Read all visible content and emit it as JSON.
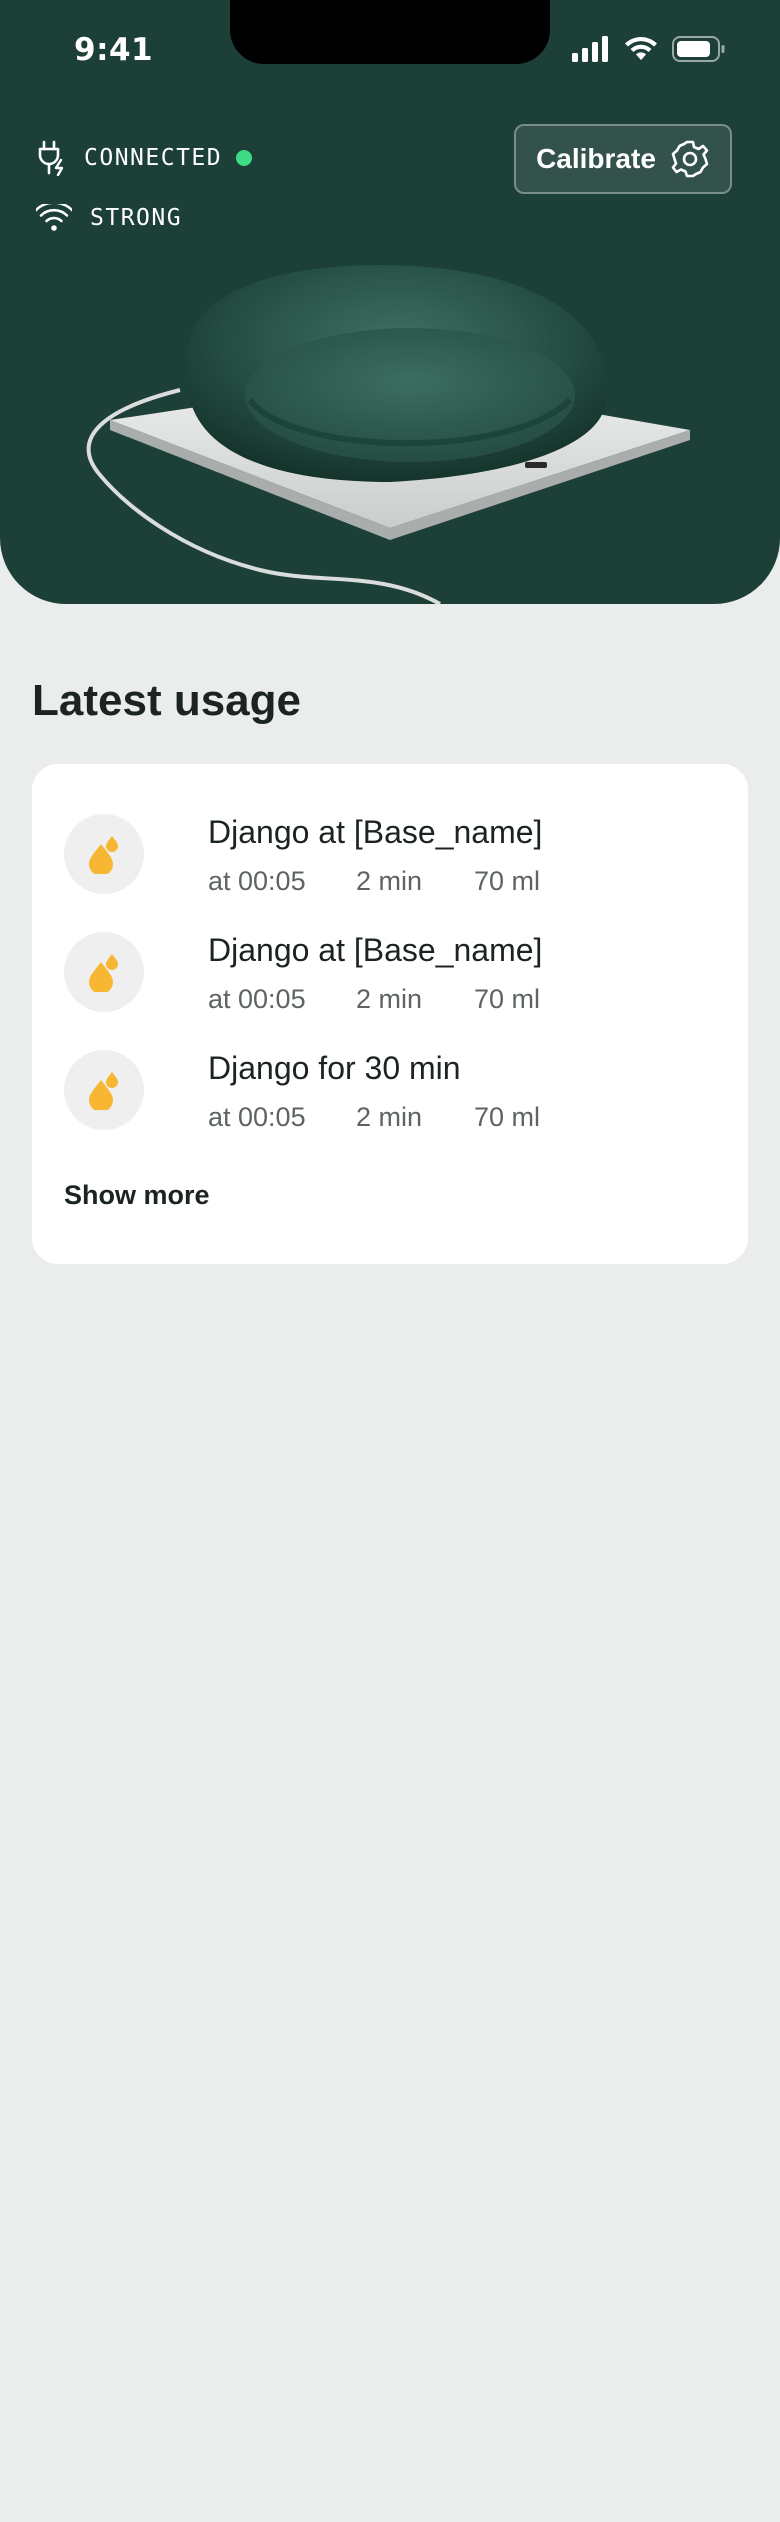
{
  "status_bar": {
    "time": "9:41",
    "icons": [
      "cellular-signal-icon",
      "wifi-icon",
      "battery-icon"
    ]
  },
  "device_status": {
    "connection_label": "CONNECTED",
    "connection_icon": "power-plug-icon",
    "connection_color": "#3DDC84",
    "signal_label": "STRONG",
    "signal_icon": "wifi-icon"
  },
  "calibrate_button": {
    "label": "Calibrate",
    "icon": "gear-icon"
  },
  "latest_usage": {
    "title": "Latest usage",
    "items": [
      {
        "title": "Django at [Base_name]",
        "time": "at 00:05",
        "duration": "2 min",
        "volume": "70 ml",
        "icon": "water-drops-icon"
      },
      {
        "title": "Django at [Base_name]",
        "time": "at 00:05",
        "duration": "2 min",
        "volume": "70 ml",
        "icon": "water-drops-icon"
      },
      {
        "title": "Django for 30 min",
        "time": "at 00:05",
        "duration": "2 min",
        "volume": "70 ml",
        "icon": "water-drops-icon"
      }
    ],
    "show_more_label": "Show more"
  },
  "colors": {
    "hero_background": "#1C3F37",
    "page_background": "#EBEDEC",
    "accent_drop": "#F7B733",
    "status_green": "#3DDC84"
  }
}
